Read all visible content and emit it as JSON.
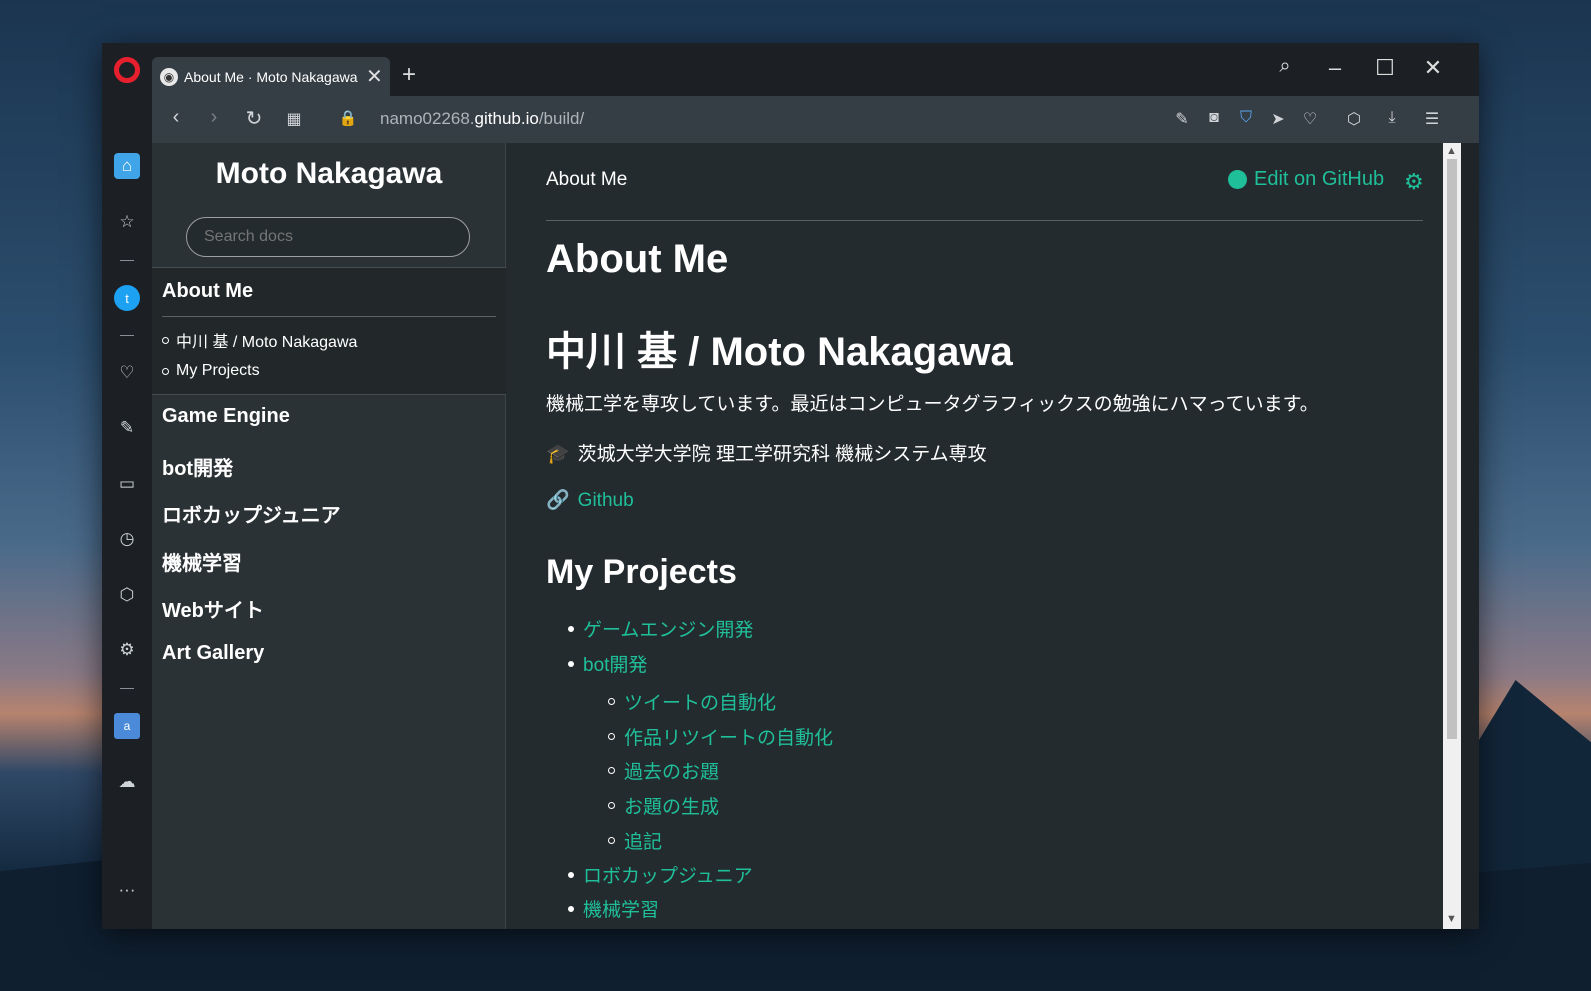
{
  "browser": {
    "tab_title": "About Me · Moto Nakagawa",
    "url_prefix": "namo02268.",
    "url_domain": "github.io",
    "url_path": "/build/"
  },
  "sidebar_nav": {
    "project_title": "Moto Nakagawa",
    "search_placeholder": "Search docs",
    "current": "About Me",
    "current_subitems": [
      "中川 基 / Moto Nakagawa",
      "My Projects"
    ],
    "items": [
      "Game Engine",
      "bot開発",
      "ロボカップジュニア",
      "機械学習",
      "Webサイト",
      "Art Gallery"
    ]
  },
  "main": {
    "breadcrumb": "About Me",
    "edit_link": "Edit on GitHub",
    "title": "About Me",
    "heading_name": "中川 基 / Moto Nakagawa",
    "intro": "機械工学を専攻しています。最近はコンピュータグラフィックスの勉強にハマっています。",
    "school": "茨城大学大学院 理工学研究科 機械システム専攻",
    "github_link": "Github",
    "projects_heading": "My Projects",
    "projects": [
      {
        "label": "ゲームエンジン開発",
        "level": 1
      },
      {
        "label": "bot開発",
        "level": 1
      },
      {
        "label": "ツイートの自動化",
        "level": 2
      },
      {
        "label": "作品リツイートの自動化",
        "level": 2
      },
      {
        "label": "過去のお題",
        "level": 2
      },
      {
        "label": "お題の生成",
        "level": 2
      },
      {
        "label": "追記",
        "level": 2
      },
      {
        "label": "ロボカップジュニア",
        "level": 1
      },
      {
        "label": "機械学習",
        "level": 1
      }
    ]
  }
}
